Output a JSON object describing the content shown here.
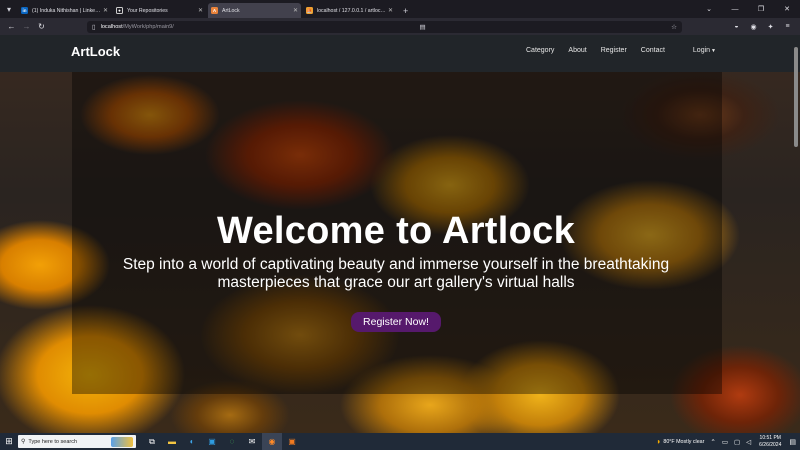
{
  "browser": {
    "tabs": [
      {
        "title": "(1) Induka Nithishan | LinkedIn",
        "favicon": "in",
        "color": "#0a66c2",
        "active": false
      },
      {
        "title": "Your Repositories",
        "favicon": "gh",
        "color": "#e6e6e6",
        "active": false
      },
      {
        "title": "ArtLock",
        "favicon": "A",
        "color": "#e8823a",
        "active": true
      },
      {
        "title": "localhost / 127.0.0.1 / artlock | ...",
        "favicon": "pma",
        "color": "#f0a030",
        "active": false
      }
    ],
    "url_host": "localhost",
    "url_path": "/MyWork/php/main9/"
  },
  "site": {
    "brand": "ArtLock",
    "nav": {
      "category": "Category",
      "about": "About",
      "register": "Register",
      "contact": "Contact",
      "login": "Login"
    },
    "hero": {
      "title": "Welcome to Artlock",
      "subtitle_line1": "Step into a world of captivating beauty and immerse yourself in the breathtaking",
      "subtitle_line2": "masterpieces that grace our art gallery's virtual halls",
      "cta": "Register Now!"
    }
  },
  "taskbar": {
    "search_placeholder": "Type here to search",
    "weather": "80°F  Mostly clear",
    "time": "10:51 PM",
    "date": "6/26/2024"
  }
}
